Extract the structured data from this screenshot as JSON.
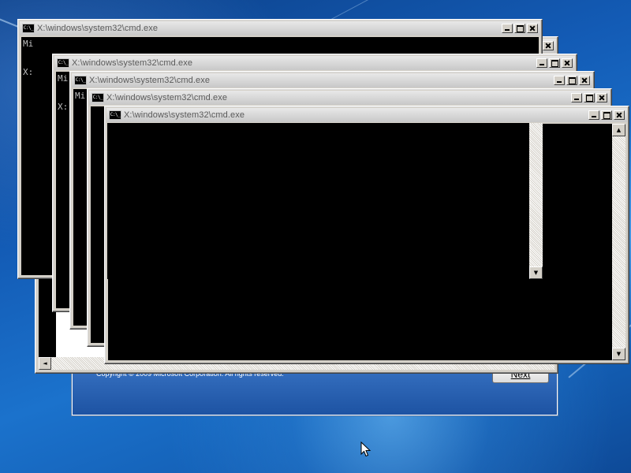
{
  "setup": {
    "copyright": "Copyright © 2009 Microsoft Corporation. All rights reserved.",
    "next_label": "Next"
  },
  "cmd": {
    "title": "X:\\windows\\system32\\cmd.exe",
    "icon_text": "C:\\_",
    "line_mi": "Mi",
    "line_x": "X:",
    "up_arrow": "▲",
    "down_arrow": "▼",
    "left_arrow": "◄"
  },
  "colors": {
    "console_bg": "#000000",
    "window_frame": "#d4d0c8",
    "title_text": "#5a5a5a",
    "wallpaper_blue": "#1b72cc"
  },
  "icons": {
    "window_icon": "cmd-icon",
    "minimize": "minimize-icon",
    "maximize": "maximize-icon",
    "close": "close-icon",
    "pointer": "mouse-pointer-icon"
  }
}
